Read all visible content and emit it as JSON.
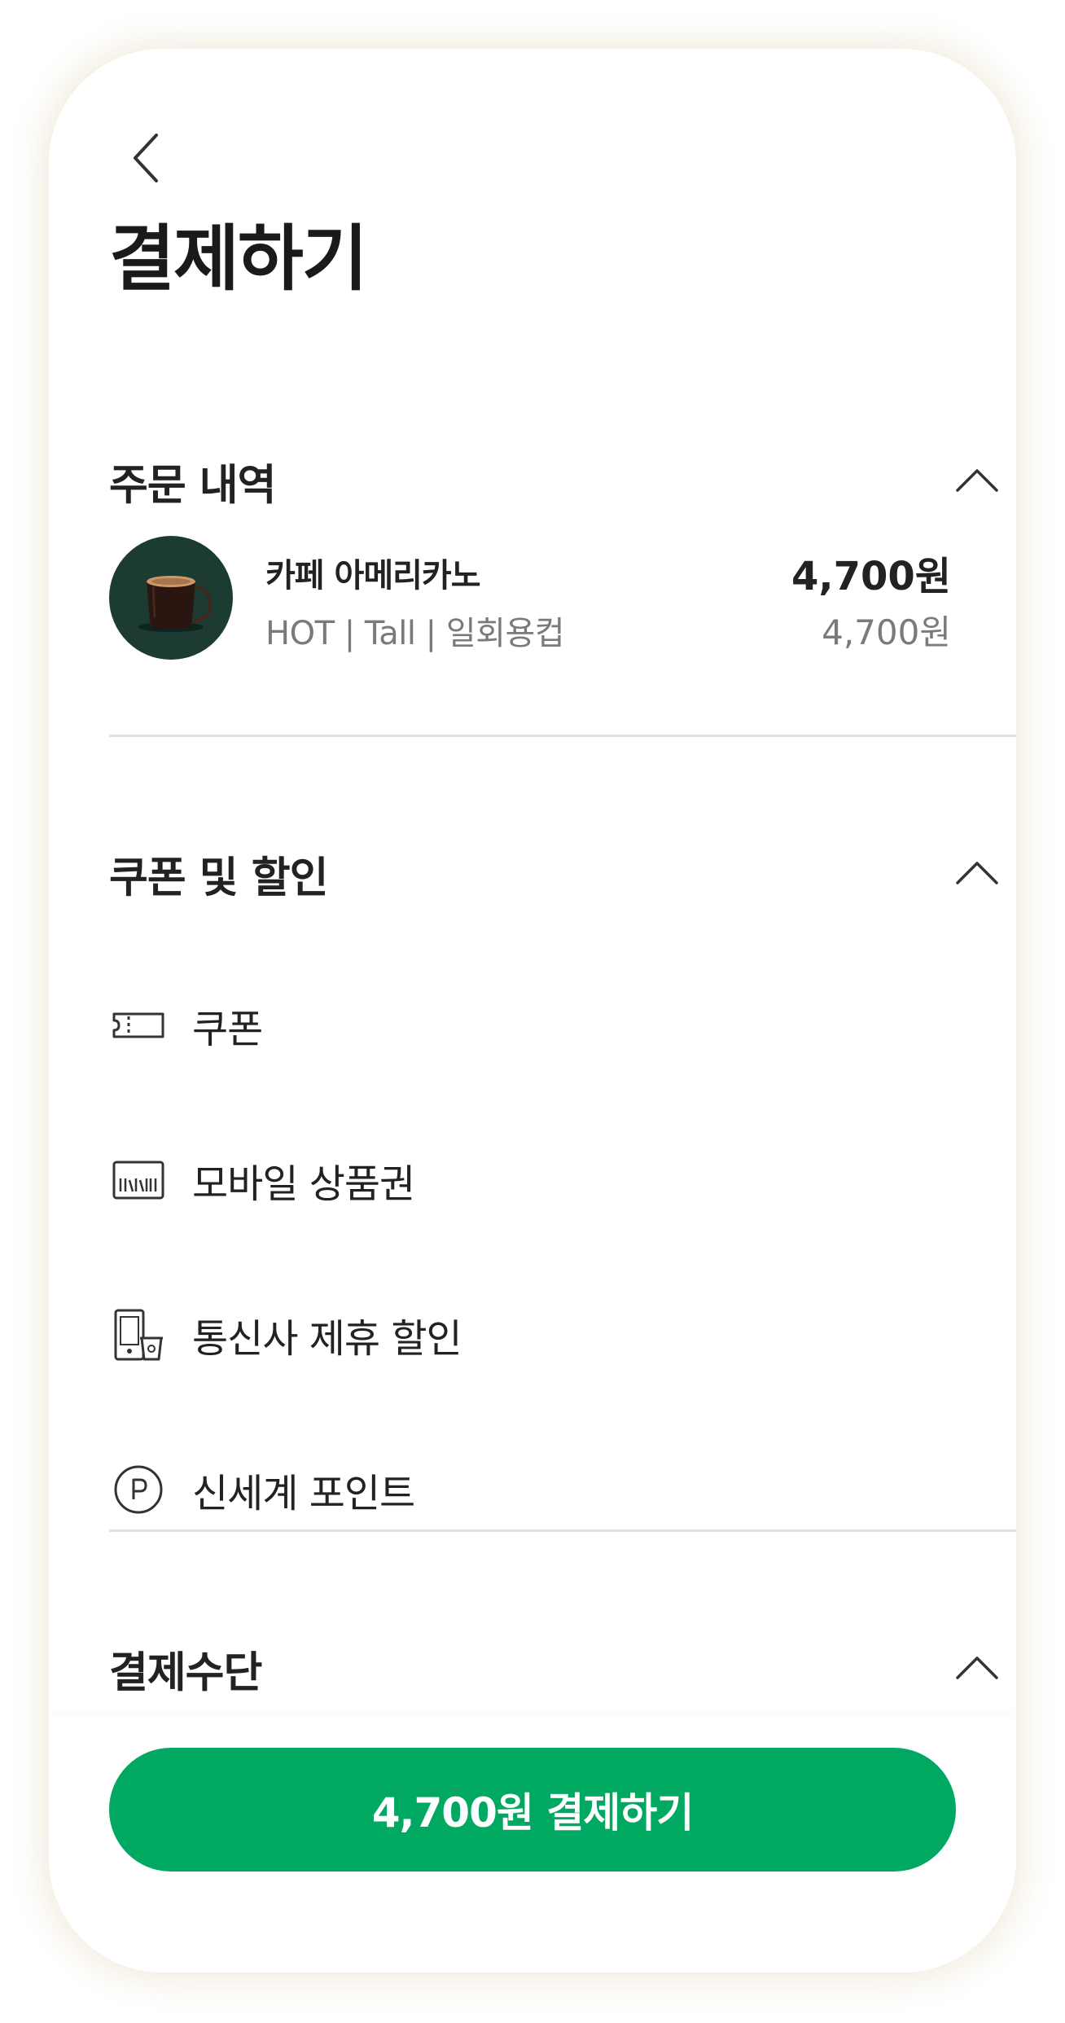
{
  "header": {
    "back_icon": "chevron-left-icon",
    "title": "결제하기"
  },
  "order_section": {
    "title": "주문 내역",
    "expanded": true,
    "item": {
      "name": "카페 아메리카노",
      "options": "HOT | Tall | 일회용컵",
      "price": "4,700원",
      "unit_price": "4,700원",
      "image": "americano-mug-image"
    }
  },
  "discount_section": {
    "title": "쿠폰 및 할인",
    "expanded": true,
    "items": [
      {
        "label": "쿠폰",
        "icon": "coupon-ticket-icon"
      },
      {
        "label": "모바일 상품권",
        "icon": "gift-card-barcode-icon"
      },
      {
        "label": "통신사 제휴 할인",
        "icon": "phone-cup-icon"
      },
      {
        "label": "신세계 포인트",
        "icon": "point-p-icon"
      }
    ]
  },
  "payment_section": {
    "title": "결제수단",
    "expanded": true
  },
  "footer": {
    "pay_button_label": "4,700원 결제하기"
  },
  "colors": {
    "accent": "#00a862",
    "thumb_background": "#1c3b32",
    "text_primary": "#222222",
    "text_secondary": "#7a7a7a",
    "divider": "#e2e2e2"
  }
}
